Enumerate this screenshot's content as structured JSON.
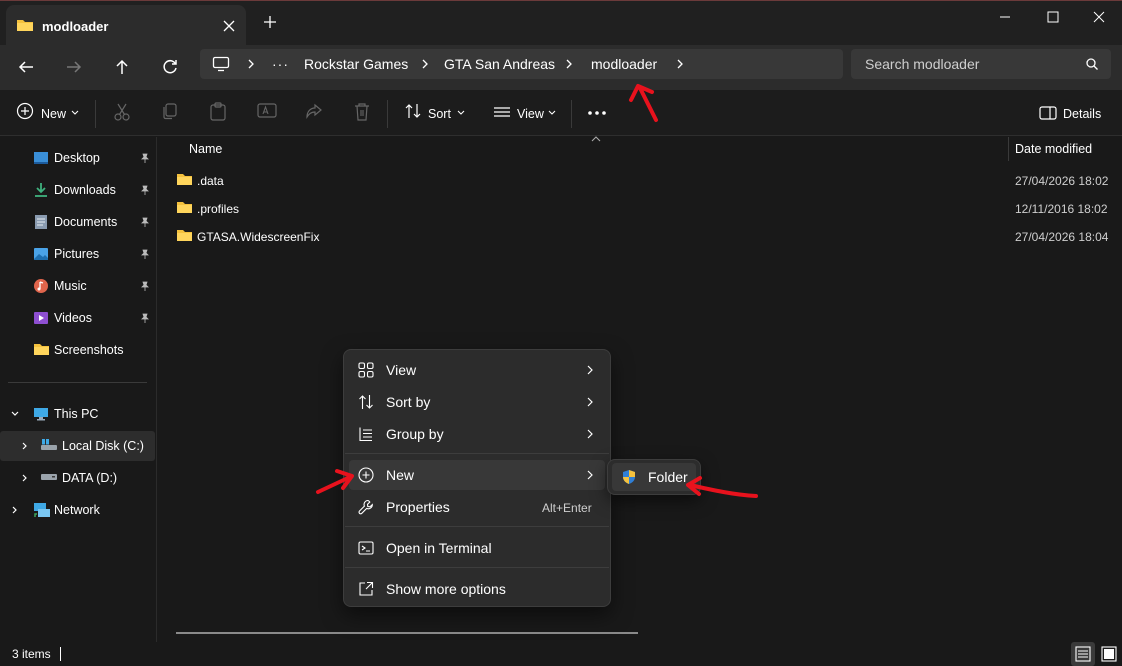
{
  "window": {
    "tab_title": "modloader",
    "minimize": "minimize",
    "maximize": "maximize",
    "close": "close"
  },
  "address": {
    "overflow": "···",
    "crumbs": [
      "Rockstar Games",
      "GTA San Andreas",
      "modloader"
    ]
  },
  "search": {
    "placeholder": "Search modloader"
  },
  "toolbar": {
    "new_label": "New",
    "sort_label": "Sort",
    "view_label": "View",
    "details_label": "Details"
  },
  "sidebar": {
    "quick_access": [
      {
        "label": "Desktop",
        "icon": "desktop-icon",
        "pinned": true
      },
      {
        "label": "Downloads",
        "icon": "downloads-icon",
        "pinned": true
      },
      {
        "label": "Documents",
        "icon": "documents-icon",
        "pinned": true
      },
      {
        "label": "Pictures",
        "icon": "pictures-icon",
        "pinned": true
      },
      {
        "label": "Music",
        "icon": "music-icon",
        "pinned": true
      },
      {
        "label": "Videos",
        "icon": "videos-icon",
        "pinned": true
      },
      {
        "label": "Screenshots",
        "icon": "folder-icon",
        "pinned": false
      }
    ],
    "this_pc": "This PC",
    "drives": [
      "Local Disk (C:)",
      "DATA (D:)"
    ],
    "network": "Network"
  },
  "columns": {
    "name": "Name",
    "date": "Date modified"
  },
  "files": [
    {
      "name": ".data",
      "date": "27/04/2026 18:02"
    },
    {
      "name": ".profiles",
      "date": "12/11/2016 18:02"
    },
    {
      "name": "GTASA.WidescreenFix",
      "date": "27/04/2026 18:04"
    }
  ],
  "status": {
    "items": "3 items"
  },
  "context_menu": {
    "items": [
      {
        "label": "View",
        "icon": "view-icon",
        "submenu": true
      },
      {
        "label": "Sort by",
        "icon": "sort-icon",
        "submenu": true
      },
      {
        "label": "Group by",
        "icon": "group-icon",
        "submenu": true
      },
      {
        "label": "New",
        "icon": "new-icon",
        "submenu": true
      },
      {
        "label": "Properties",
        "icon": "wrench-icon",
        "shortcut": "Alt+Enter"
      },
      {
        "label": "Open in Terminal",
        "icon": "terminal-icon"
      },
      {
        "label": "Show more options",
        "icon": "more-options-icon"
      }
    ],
    "submenu_new": {
      "label": "Folder"
    }
  },
  "colors": {
    "accent_folder": "#f4c13d",
    "annotation": "#e8121d"
  }
}
